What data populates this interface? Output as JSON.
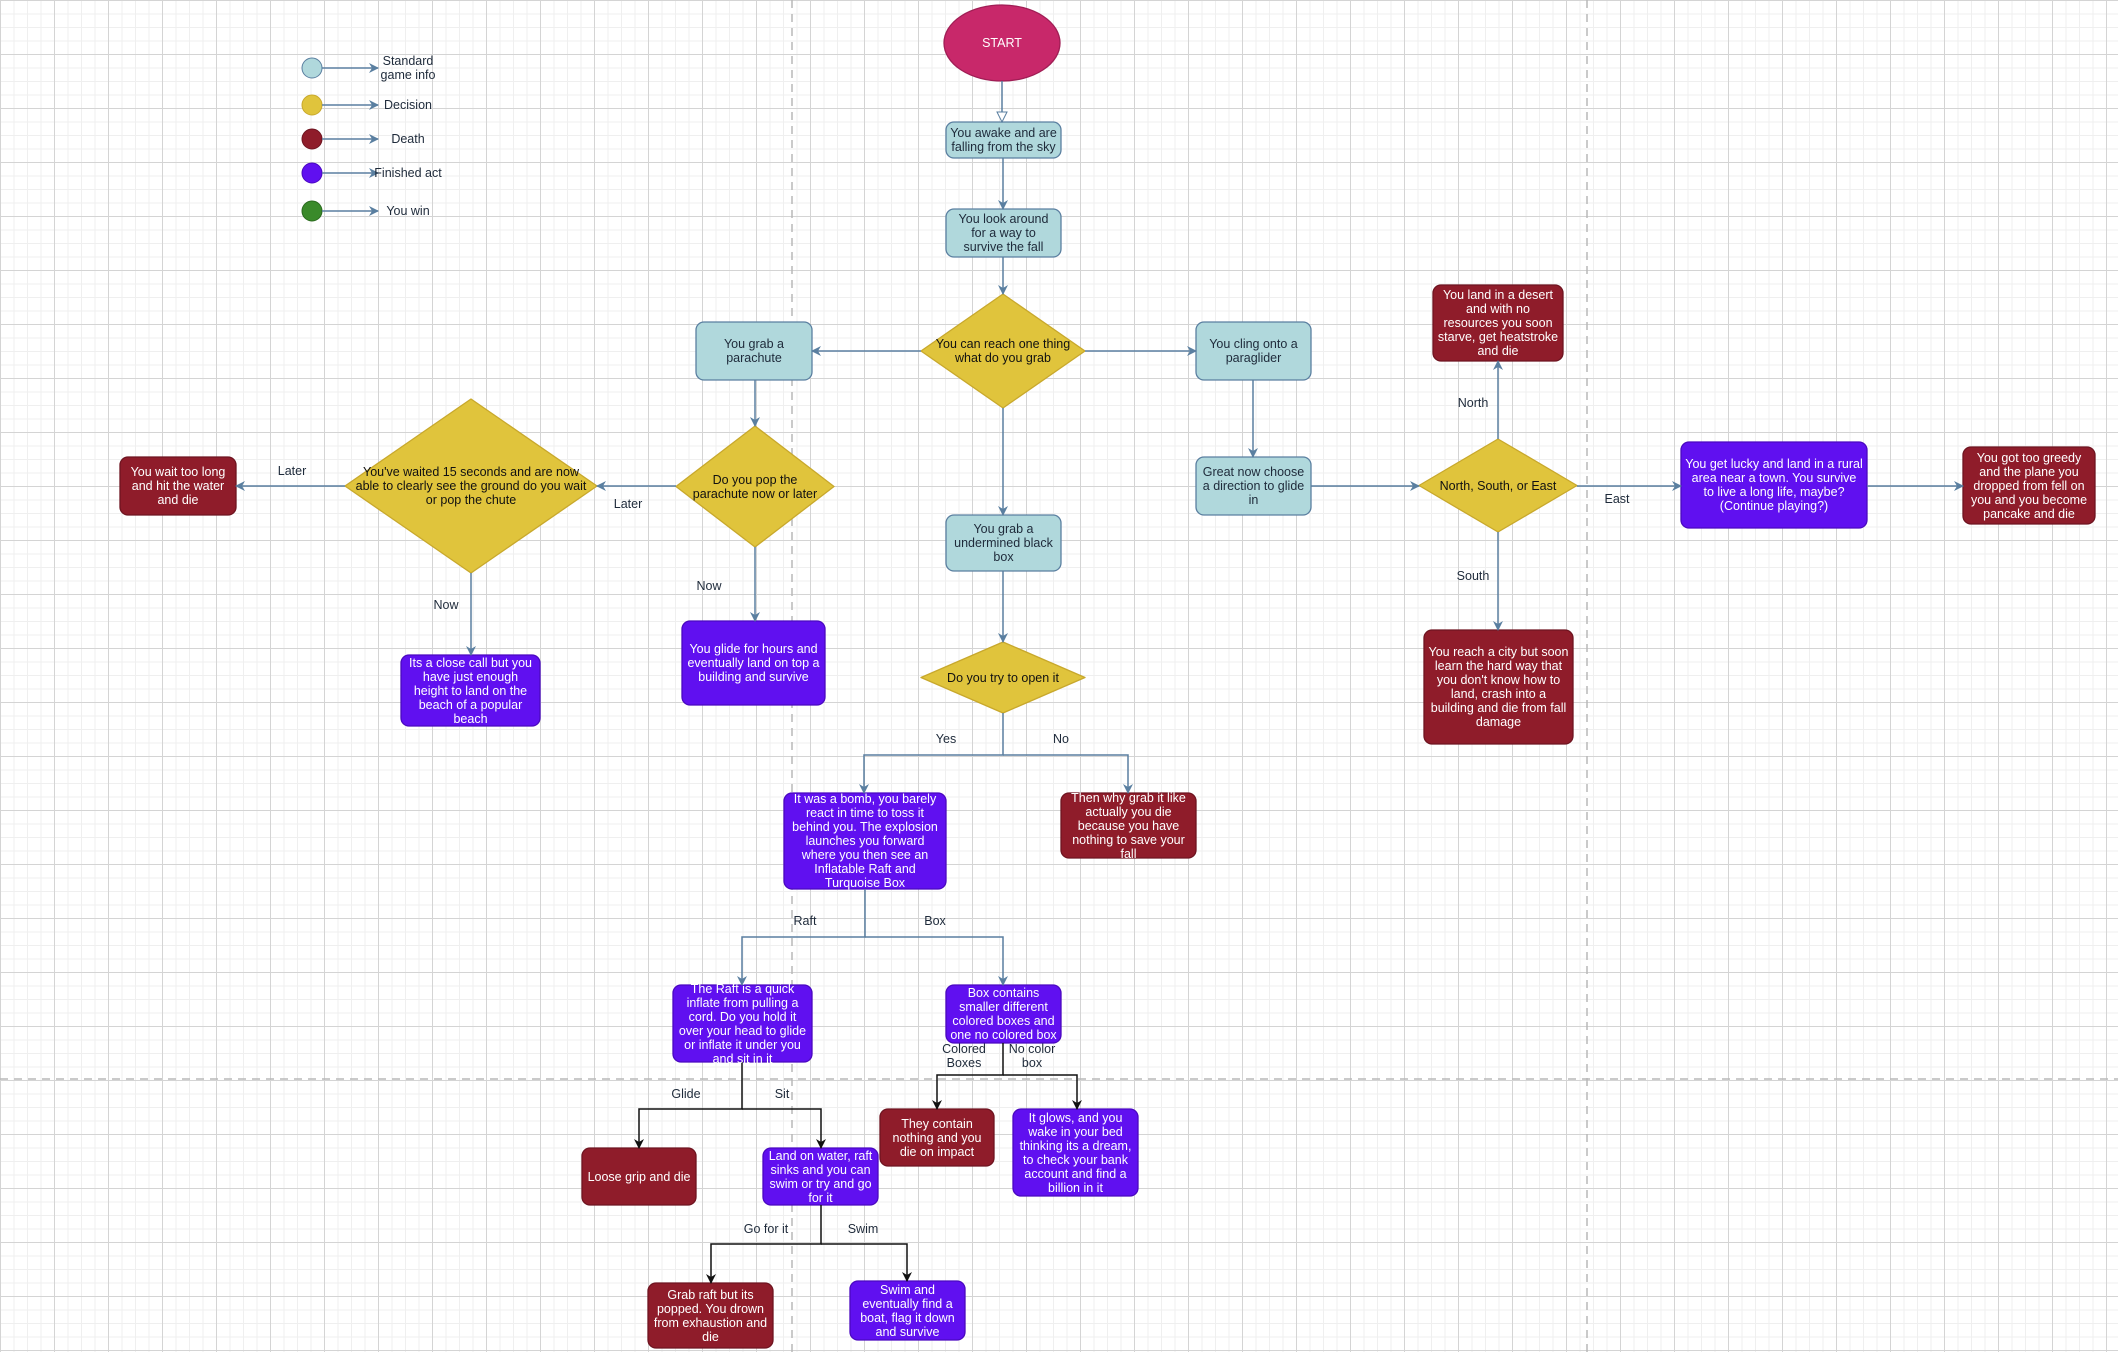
{
  "colors": {
    "info": "#b0d8dc",
    "decision": "#e0c43c",
    "death": "#8f1c2a",
    "act": "#6010f0",
    "win": "#3a8a2a",
    "start": "#c8286a",
    "edge": "#5a7fa0"
  },
  "legend": [
    {
      "type": "info",
      "label": "Standard game info"
    },
    {
      "type": "decision",
      "label": "Decision"
    },
    {
      "type": "death",
      "label": "Death"
    },
    {
      "type": "act",
      "label": "Finished act"
    },
    {
      "type": "win",
      "label": "You win"
    }
  ],
  "nodes": {
    "start": {
      "type": "start",
      "text": "START"
    },
    "awake": {
      "type": "info",
      "text": "You awake and are falling from the sky"
    },
    "look": {
      "type": "info",
      "text": "You look around for a way to survive the fall"
    },
    "reach": {
      "type": "decision",
      "text": "You can reach one thing what do you grab"
    },
    "parachute": {
      "type": "info",
      "text": "You grab a parachute"
    },
    "paraglider": {
      "type": "info",
      "text": "You cling onto a paraglider"
    },
    "pop": {
      "type": "decision",
      "text": "Do you pop the parachute now or later"
    },
    "waited": {
      "type": "decision",
      "text": "You've waited 15 seconds and are now able to clearly see the ground do you wait or pop the chute"
    },
    "waittoolong": {
      "type": "death",
      "text": "You wait too long and hit the water and die"
    },
    "closecall": {
      "type": "act",
      "text": "Its a close call but you have just enough height to land on the beach of a popular beach"
    },
    "glidehours": {
      "type": "act",
      "text": "You glide for hours and eventually land on top a building and survive"
    },
    "blackbox": {
      "type": "info",
      "text": "You grab a undermined black box"
    },
    "open": {
      "type": "decision",
      "text": "Do you try to open it"
    },
    "bomb": {
      "type": "act",
      "text": "It was a bomb, you barely react in time to toss it behind you. The explosion launches you forward where you then see an Inflatable Raft and Turquoise Box"
    },
    "whygrab": {
      "type": "death",
      "text": "Then why grab it like actually you die because you have nothing to save your fall"
    },
    "raft": {
      "type": "act",
      "text": "The Raft is a quick inflate from pulling a cord. Do you hold it over your head to glide or inflate it under you and sit in it"
    },
    "boxcontains": {
      "type": "act",
      "text": "Box contains smaller different colored boxes and one no colored box"
    },
    "loosegrip": {
      "type": "death",
      "text": "Loose grip and die"
    },
    "landwater": {
      "type": "act",
      "text": "Land on water, raft sinks and you can swim or try and go for it"
    },
    "containnothing": {
      "type": "death",
      "text": "They contain nothing and you die on impact"
    },
    "glows": {
      "type": "act",
      "text": "It glows, and you wake in your bed thinking its a dream, to check your bank account and find a billion in it"
    },
    "grabraft": {
      "type": "death",
      "text": "Grab raft but its popped. You drown from exhaustion and die"
    },
    "swim": {
      "type": "act",
      "text": "Swim and eventually find a boat, flag it down and survive"
    },
    "greatnow": {
      "type": "info",
      "text": "Great now choose a direction to glide in"
    },
    "nse": {
      "type": "decision",
      "text": "North, South, or East"
    },
    "desert": {
      "type": "death",
      "text": "You land in a desert and with no resources you soon starve, get heatstroke and die"
    },
    "city": {
      "type": "death",
      "text": "You reach a city but soon learn the hard way that you don't know how to land, crash into a building and die from fall damage"
    },
    "lucky": {
      "type": "act",
      "text": "You get lucky and land in a rural area near a town. You survive to live a long life, maybe? (Continue playing?)"
    },
    "greedy": {
      "type": "death",
      "text": "You got too greedy and the plane you dropped from fell on you and you become pancake and die"
    }
  },
  "edge_labels": {
    "later1": "Later",
    "later2": "Later",
    "now1": "Now",
    "now2": "Now",
    "north": "North",
    "south": "South",
    "east": "East",
    "yes": "Yes",
    "no": "No",
    "raft": "Raft",
    "box": "Box",
    "colored": "Colored Boxes",
    "nocolor": "No color box",
    "glide": "Glide",
    "sit": "Sit",
    "gofor": "Go for it",
    "swim": "Swim"
  }
}
